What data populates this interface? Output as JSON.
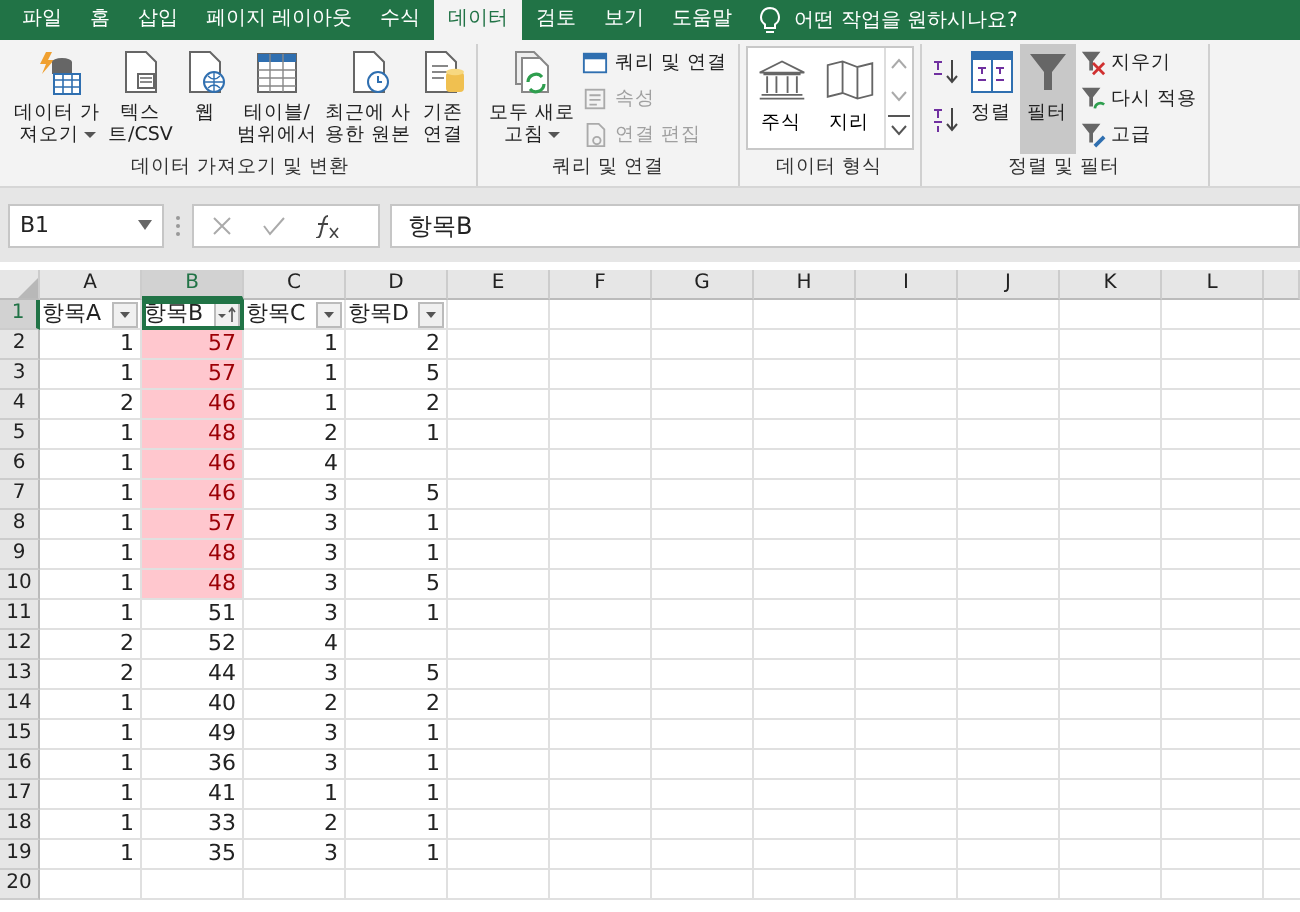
{
  "tabs": [
    {
      "label": "파일",
      "selected": false
    },
    {
      "label": "홈",
      "selected": false
    },
    {
      "label": "삽입",
      "selected": false
    },
    {
      "label": "페이지 레이아웃",
      "selected": false
    },
    {
      "label": "수식",
      "selected": false
    },
    {
      "label": "데이터",
      "selected": true
    },
    {
      "label": "검토",
      "selected": false
    },
    {
      "label": "보기",
      "selected": false
    },
    {
      "label": "도움말",
      "selected": false
    }
  ],
  "tell_me": {
    "placeholder": "어떤 작업을 원하시나요?"
  },
  "ribbon": {
    "groups": [
      {
        "label": "데이터 가져오기 및 변환",
        "items": [
          {
            "kind": "large",
            "label": "데이터 가\n져오기",
            "dropdown": true
          },
          {
            "kind": "large",
            "label": "텍스\n트/CSV"
          },
          {
            "kind": "large",
            "label": "웹"
          },
          {
            "kind": "large",
            "label": "테이블/\n범위에서"
          },
          {
            "kind": "large",
            "label": "최근에 사\n용한 원본"
          },
          {
            "kind": "large",
            "label": "기존\n연결"
          }
        ]
      },
      {
        "label": "쿼리 및 연결",
        "items": [
          {
            "kind": "large",
            "label": "모두 새로\n고침",
            "dropdown": true
          },
          {
            "kind": "small",
            "label": "쿼리 및 연결",
            "disabled": false
          },
          {
            "kind": "small",
            "label": "속성",
            "disabled": true
          },
          {
            "kind": "small",
            "label": "연결 편집",
            "disabled": true
          }
        ]
      },
      {
        "label": "데이터 형식",
        "items": [
          {
            "kind": "gallery",
            "label": "주식"
          },
          {
            "kind": "gallery",
            "label": "지리"
          }
        ]
      },
      {
        "label": "정렬 및 필터",
        "items": [
          {
            "kind": "sort-pair"
          },
          {
            "kind": "large",
            "label": "정렬",
            "selected": false
          },
          {
            "kind": "large",
            "label": "필터",
            "selected": true
          },
          {
            "kind": "small",
            "label": "지우기",
            "disabled": false
          },
          {
            "kind": "small",
            "label": "다시 적용",
            "disabled": false
          },
          {
            "kind": "small",
            "label": "고급",
            "disabled": false
          }
        ]
      }
    ]
  },
  "formula_bar": {
    "name_box": "B1",
    "value": "항목B"
  },
  "sheet": {
    "columns": [
      {
        "label": "A",
        "selected": false
      },
      {
        "label": "B",
        "selected": true
      },
      {
        "label": "C",
        "selected": false
      },
      {
        "label": "D",
        "selected": false
      },
      {
        "label": "E",
        "selected": false
      },
      {
        "label": "F",
        "selected": false
      },
      {
        "label": "G",
        "selected": false
      },
      {
        "label": "H",
        "selected": false
      },
      {
        "label": "I",
        "selected": false
      },
      {
        "label": "J",
        "selected": false
      },
      {
        "label": "K",
        "selected": false
      },
      {
        "label": "L",
        "selected": false
      }
    ],
    "rows": [
      {
        "label": "1",
        "selected": true,
        "cells": [
          {
            "value": "항목A",
            "kind": "header",
            "sorted": false,
            "selected": false
          },
          {
            "value": "항목B",
            "kind": "header",
            "sorted": true,
            "selected": true
          },
          {
            "value": "항목C",
            "kind": "header",
            "sorted": false,
            "selected": false
          },
          {
            "value": "항목D",
            "kind": "header",
            "sorted": false,
            "selected": false
          }
        ]
      },
      {
        "label": "2",
        "selected": false,
        "cells": [
          {
            "value": "1",
            "highlight": false
          },
          {
            "value": "57",
            "highlight": true
          },
          {
            "value": "1",
            "highlight": false
          },
          {
            "value": "2",
            "highlight": false
          }
        ]
      },
      {
        "label": "3",
        "selected": false,
        "cells": [
          {
            "value": "1",
            "highlight": false
          },
          {
            "value": "57",
            "highlight": true
          },
          {
            "value": "1",
            "highlight": false
          },
          {
            "value": "5",
            "highlight": false
          }
        ]
      },
      {
        "label": "4",
        "selected": false,
        "cells": [
          {
            "value": "2",
            "highlight": false
          },
          {
            "value": "46",
            "highlight": true
          },
          {
            "value": "1",
            "highlight": false
          },
          {
            "value": "2",
            "highlight": false
          }
        ]
      },
      {
        "label": "5",
        "selected": false,
        "cells": [
          {
            "value": "1",
            "highlight": false
          },
          {
            "value": "48",
            "highlight": true
          },
          {
            "value": "2",
            "highlight": false
          },
          {
            "value": "1",
            "highlight": false
          }
        ]
      },
      {
        "label": "6",
        "selected": false,
        "cells": [
          {
            "value": "1",
            "highlight": false
          },
          {
            "value": "46",
            "highlight": true
          },
          {
            "value": "4",
            "highlight": false
          }
        ]
      },
      {
        "label": "7",
        "selected": false,
        "cells": [
          {
            "value": "1",
            "highlight": false
          },
          {
            "value": "46",
            "highlight": true
          },
          {
            "value": "3",
            "highlight": false
          },
          {
            "value": "5",
            "highlight": false
          }
        ]
      },
      {
        "label": "8",
        "selected": false,
        "cells": [
          {
            "value": "1",
            "highlight": false
          },
          {
            "value": "57",
            "highlight": true
          },
          {
            "value": "3",
            "highlight": false
          },
          {
            "value": "1",
            "highlight": false
          }
        ]
      },
      {
        "label": "9",
        "selected": false,
        "cells": [
          {
            "value": "1",
            "highlight": false
          },
          {
            "value": "48",
            "highlight": true
          },
          {
            "value": "3",
            "highlight": false
          },
          {
            "value": "1",
            "highlight": false
          }
        ]
      },
      {
        "label": "10",
        "selected": false,
        "cells": [
          {
            "value": "1",
            "highlight": false
          },
          {
            "value": "48",
            "highlight": true
          },
          {
            "value": "3",
            "highlight": false
          },
          {
            "value": "5",
            "highlight": false
          }
        ]
      },
      {
        "label": "11",
        "selected": false,
        "cells": [
          {
            "value": "1",
            "highlight": false
          },
          {
            "value": "51",
            "highlight": false
          },
          {
            "value": "3",
            "highlight": false
          },
          {
            "value": "1",
            "highlight": false
          }
        ]
      },
      {
        "label": "12",
        "selected": false,
        "cells": [
          {
            "value": "2",
            "highlight": false
          },
          {
            "value": "52",
            "highlight": false
          },
          {
            "value": "4",
            "highlight": false
          }
        ]
      },
      {
        "label": "13",
        "selected": false,
        "cells": [
          {
            "value": "2",
            "highlight": false
          },
          {
            "value": "44",
            "highlight": false
          },
          {
            "value": "3",
            "highlight": false
          },
          {
            "value": "5",
            "highlight": false
          }
        ]
      },
      {
        "label": "14",
        "selected": false,
        "cells": [
          {
            "value": "1",
            "highlight": false
          },
          {
            "value": "40",
            "highlight": false
          },
          {
            "value": "2",
            "highlight": false
          },
          {
            "value": "2",
            "highlight": false
          }
        ]
      },
      {
        "label": "15",
        "selected": false,
        "cells": [
          {
            "value": "1",
            "highlight": false
          },
          {
            "value": "49",
            "highlight": false
          },
          {
            "value": "3",
            "highlight": false
          },
          {
            "value": "1",
            "highlight": false
          }
        ]
      },
      {
        "label": "16",
        "selected": false,
        "cells": [
          {
            "value": "1",
            "highlight": false
          },
          {
            "value": "36",
            "highlight": false
          },
          {
            "value": "3",
            "highlight": false
          },
          {
            "value": "1",
            "highlight": false
          }
        ]
      },
      {
        "label": "17",
        "selected": false,
        "cells": [
          {
            "value": "1",
            "highlight": false
          },
          {
            "value": "41",
            "highlight": false
          },
          {
            "value": "1",
            "highlight": false
          },
          {
            "value": "1",
            "highlight": false
          }
        ]
      },
      {
        "label": "18",
        "selected": false,
        "cells": [
          {
            "value": "1",
            "highlight": false
          },
          {
            "value": "33",
            "highlight": false
          },
          {
            "value": "2",
            "highlight": false
          },
          {
            "value": "1",
            "highlight": false
          }
        ]
      },
      {
        "label": "19",
        "selected": false,
        "cells": [
          {
            "value": "1",
            "highlight": false
          },
          {
            "value": "35",
            "highlight": false
          },
          {
            "value": "3",
            "highlight": false
          },
          {
            "value": "1",
            "highlight": false
          }
        ]
      },
      {
        "label": "20",
        "selected": false,
        "cells": []
      }
    ]
  }
}
